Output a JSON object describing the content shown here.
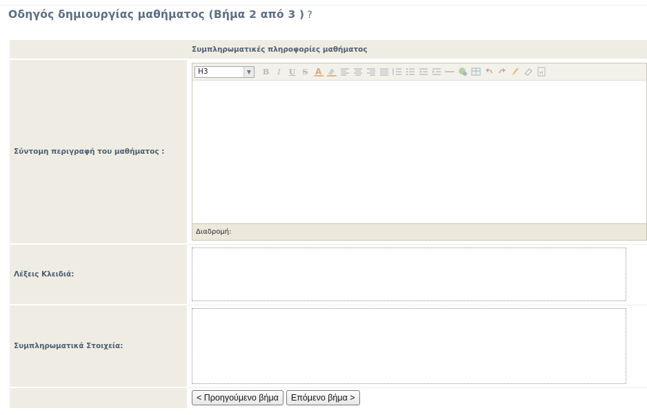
{
  "page": {
    "title": "Οδηγός δημιουργίας μαθήματος (Βήμα 2 από 3 )",
    "help_icon": "ⓘ"
  },
  "form": {
    "section_header": "Συμπληρωματικές πληροφορίες μαθήματος",
    "description_label": "Σύντομη περιγραφή του μαθήματος :",
    "keywords_label": "Λέξεις Κλειδιά:",
    "extra_label": "Συμπληρωματικά Στοιχεία:"
  },
  "editor": {
    "format_value": "H3",
    "path_label": "Διαδρομή:",
    "toolbar_icons": [
      "bold-icon",
      "italic-icon",
      "underline-icon",
      "strikethrough-icon",
      "text-color-icon",
      "highlight-icon",
      "align-left-icon",
      "align-center-icon",
      "align-right-icon",
      "justify-icon",
      "numbered-list-icon",
      "bulleted-list-icon",
      "outdent-icon",
      "indent-icon",
      "horizontal-rule-icon",
      "link-icon",
      "table-icon",
      "undo-icon",
      "redo-icon",
      "cleanup-icon",
      "eraser-icon",
      "html-source-icon"
    ]
  },
  "buttons": {
    "prev": "< Προηγούμενο βήμα",
    "next": "Επόμενο βήμα >"
  },
  "colors": {
    "label_bg": "#efede3",
    "title": "#5b6e84"
  }
}
